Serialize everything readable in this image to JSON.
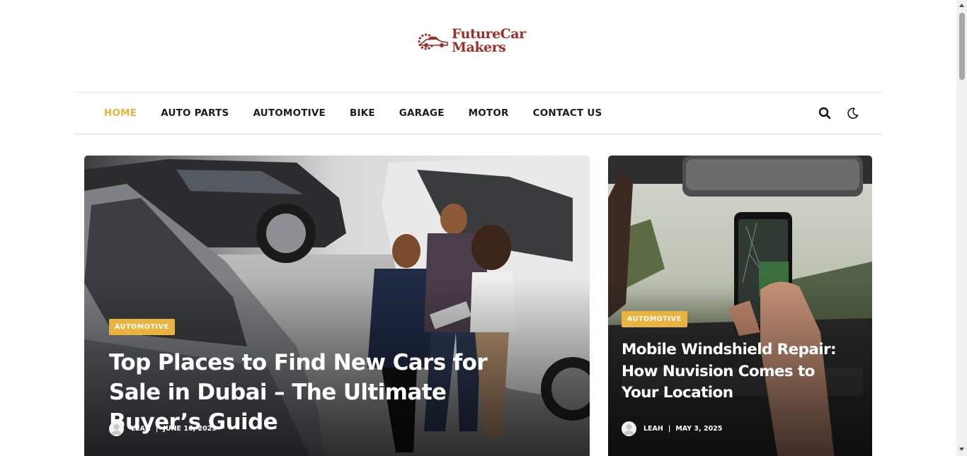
{
  "brand": {
    "line1": "FutureCar",
    "line2": "Makers",
    "color": "#9b2f2a"
  },
  "nav": {
    "items": [
      "HOME",
      "AUTO PARTS",
      "AUTOMOTIVE",
      "BIKE",
      "GARAGE",
      "MOTOR",
      "CONTACT US"
    ],
    "active_color": "#e8b43f",
    "icons": [
      "search-icon",
      "moon-icon"
    ]
  },
  "posts": [
    {
      "category": "AUTOMOTIVE",
      "title": "Top Places to Find New Cars for Sale in Dubai – The Ultimate Buyer’s Guide",
      "author": "LEAH",
      "date": "JUNE 16, 2025"
    },
    {
      "category": "AUTOMOTIVE",
      "title": "Mobile Windshield Repair: How Nuvision Comes to Your Location",
      "author": "LEAH",
      "date": "MAY 3, 2025"
    }
  ]
}
